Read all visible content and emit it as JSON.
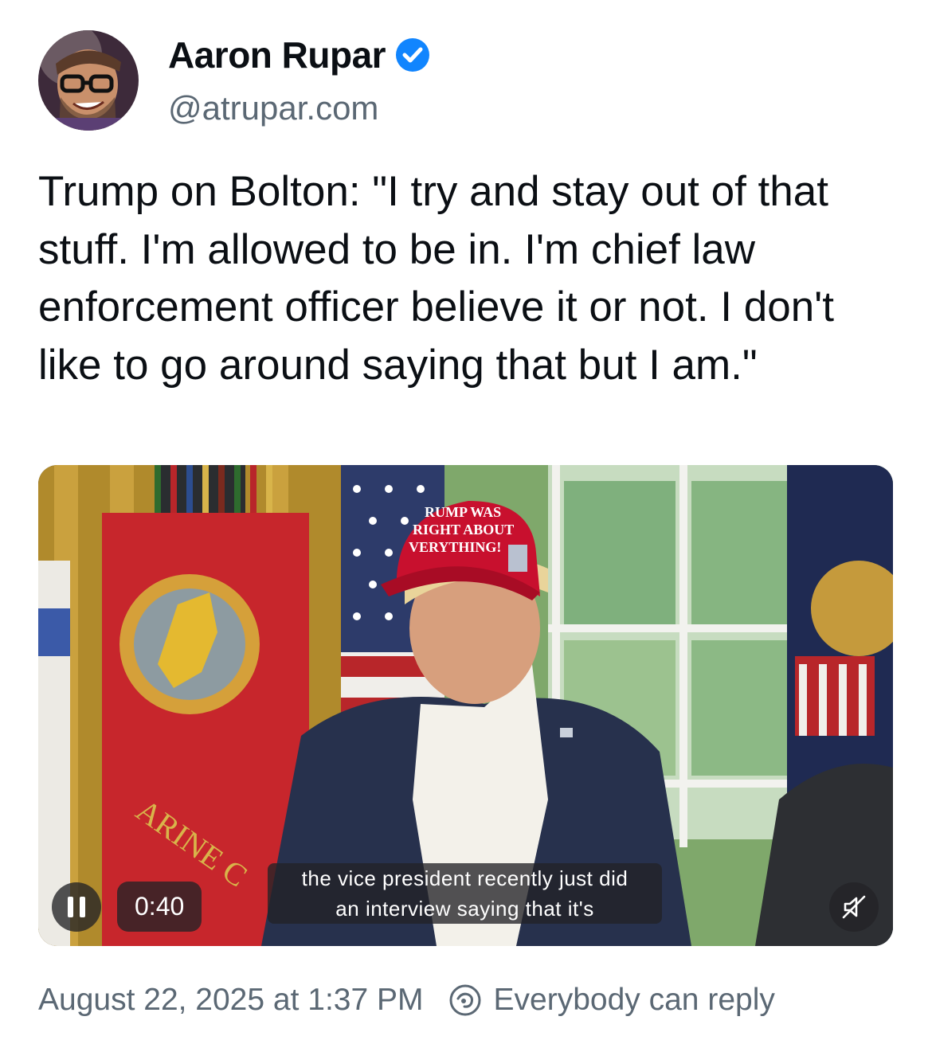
{
  "author": {
    "display_name": "Aaron Rupar",
    "handle": "@atrupar.com",
    "verified": true
  },
  "post": {
    "text": "Trump on Bolton: \"I try and stay out of that stuff. I'm allowed to be in. I'm chief law enforcement officer believe it or not. I don't like to go around saying that but I am.\""
  },
  "video": {
    "elapsed": "0:40",
    "hat_text": [
      "RUMP WAS",
      "RIGHT ABOUT",
      "VERYTHING!"
    ],
    "flag_text": "ARINE C",
    "caption_line1": "the vice president recently just did",
    "caption_line2": "an interview saying that it's",
    "playing": true,
    "muted": true
  },
  "footer": {
    "timestamp": "August 22, 2025 at 1:37 PM",
    "reply_setting": "Everybody can reply"
  },
  "colors": {
    "accent": "#1185fe",
    "secondary_text": "#5b6874",
    "hat_red": "#c8102e"
  },
  "icons": [
    "verified-check-icon",
    "pause-icon",
    "speaker-muted-icon",
    "reply-restriction-icon"
  ]
}
